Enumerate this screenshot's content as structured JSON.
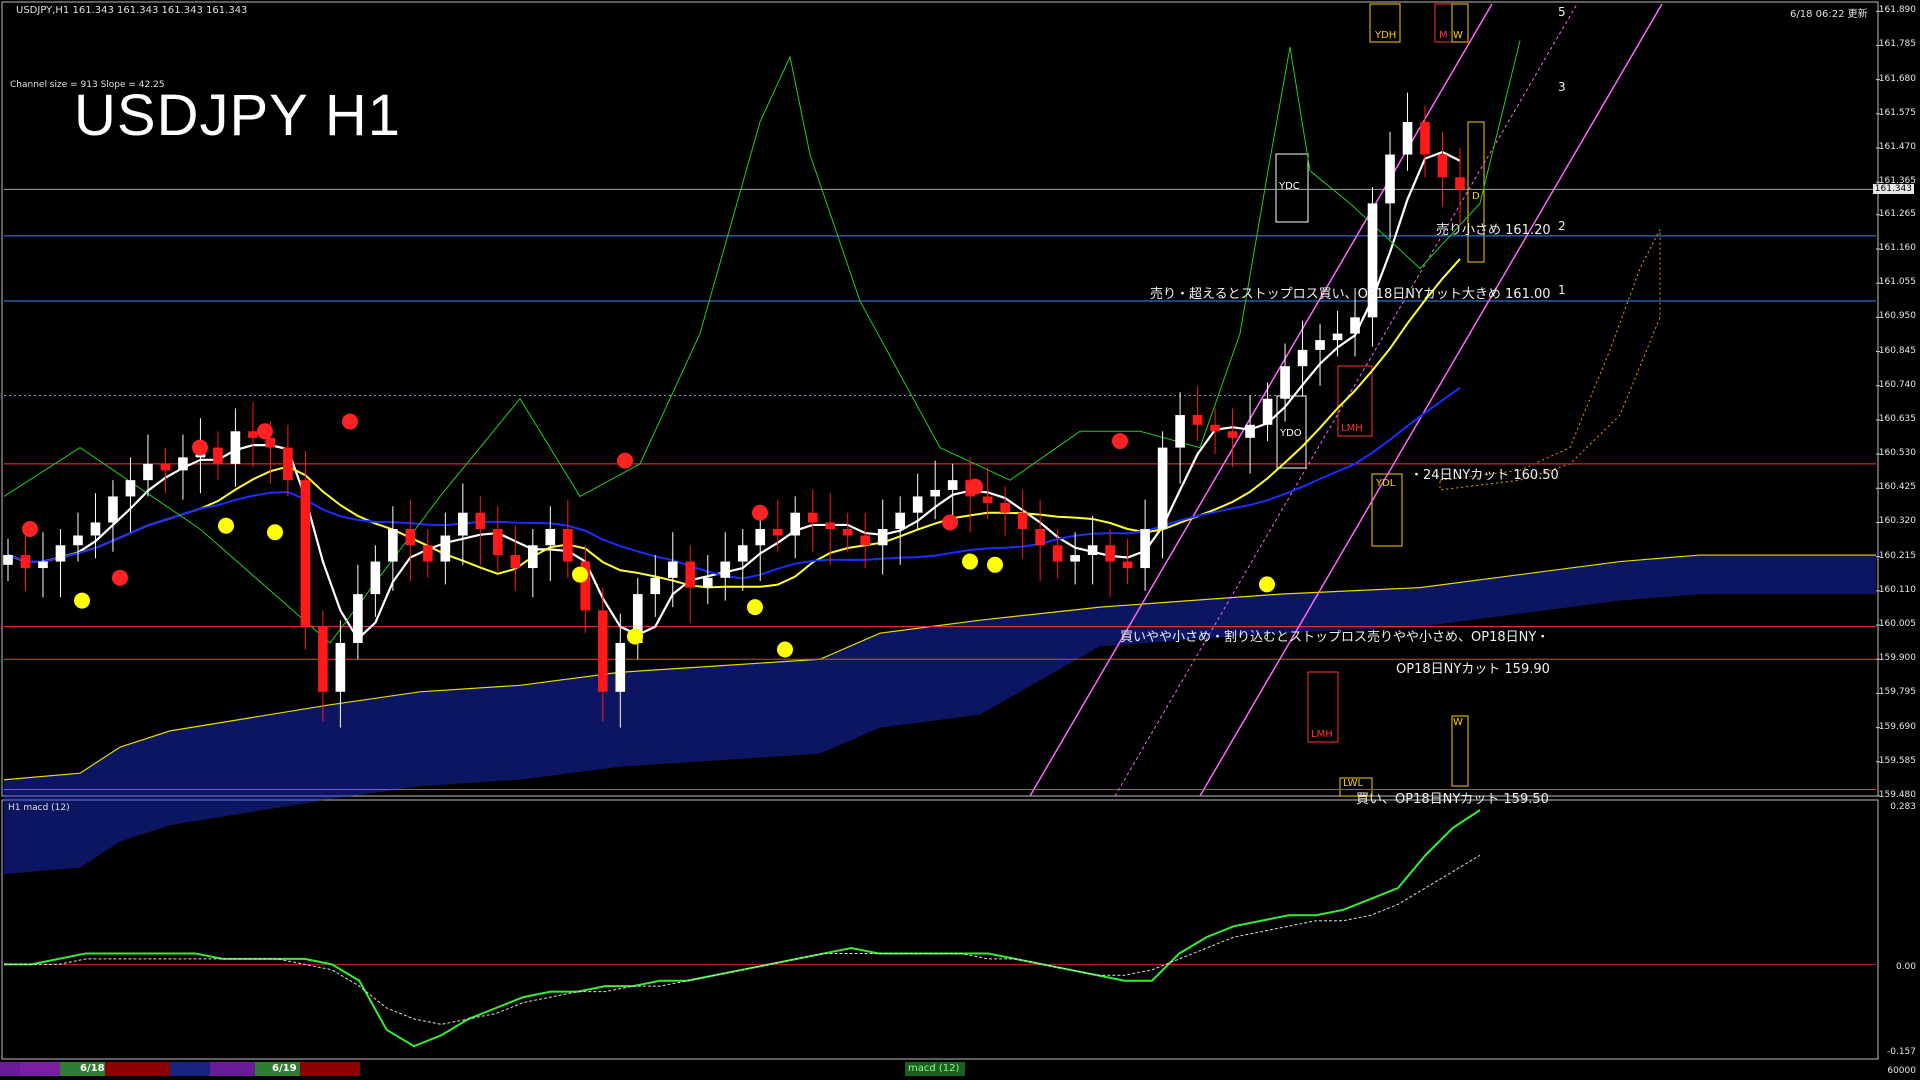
{
  "header": {
    "symbol_info": "USDJPY,H1  161.343 161.343 161.343 161.343",
    "datetime_label": "6/18 06:22 更新",
    "channel_info": "Channel size = 913 Slope = 42.25",
    "chart_title": "USDJPY H1"
  },
  "indicator_label": "H1  macd (12)",
  "colors": {
    "background": "#000000",
    "bull_candle": "#ffffff",
    "bear_candle": "#ff1a1a",
    "ma_white": "#ffffff",
    "ma_yellow": "#ffff33",
    "ma_blue": "#1a2eff",
    "channel_magenta": "#ff66ff",
    "kumo_blue": "#1a2fd6",
    "kumo_orange": "#ff9900",
    "green_osc": "#22cc22",
    "macd_green": "#33ee33",
    "macd_pink": "#ff8899",
    "blue_level": "#3a8cff",
    "red_level": "#ff3333"
  },
  "price_axis": {
    "labels": [
      "161.890",
      "161.785",
      "161.680",
      "161.575",
      "161.470",
      "161.365",
      "161.265",
      "161.160",
      "161.055",
      "160.950",
      "160.845",
      "160.740",
      "160.635",
      "160.530",
      "160.425",
      "160.320",
      "160.215",
      "160.110",
      "160.005",
      "159.900",
      "159.795",
      "159.690",
      "159.585",
      "159.480"
    ],
    "current_price": "161.343"
  },
  "macd_axis": {
    "labels": [
      "0.283",
      "0.00",
      "-0.157",
      "60000"
    ]
  },
  "levels": [
    {
      "label": "売り小さめ 161.20",
      "price": 161.2,
      "color": "#3a8cff",
      "number": "2"
    },
    {
      "label": "売り・超えるとストップロス買い、OP18日NYカット大きめ 161.00",
      "price": 161.0,
      "color": "#3a8cff",
      "number": "1"
    },
    {
      "label": "・24日NYカット 160.50",
      "price": 160.5,
      "color": "#ff3333",
      "number": ""
    },
    {
      "label": "買いやや小さめ・割り込むとストップロス売りやや小さめ、OP18日NY・",
      "price": 160.0,
      "color": "#ff3333",
      "number": ""
    },
    {
      "label": "OP18日NYカット 159.90",
      "price": 159.9,
      "color": "#ff3333",
      "number": ""
    },
    {
      "label": "買い、OP18日NYカット 159.50",
      "price": 159.5,
      "color": "#ff3333",
      "number": ""
    }
  ],
  "channel_numbers": [
    "5",
    "3"
  ],
  "box_tags": {
    "ydh": "YDH",
    "m": "M",
    "w": "W",
    "ydc": "YDC",
    "d": "D",
    "ydo": "YDO",
    "lmh": "LMH",
    "ydl": "YDL",
    "lmh2": "LMH",
    "w2": "W",
    "lwl": "LWL"
  },
  "date_tags": [
    "6/18",
    "6/19"
  ],
  "bottom_tab": "macd (12)",
  "chart_data": {
    "type": "candlestick",
    "title": "USDJPY H1",
    "timeframe": "H1",
    "ylim": [
      159.48,
      161.9
    ],
    "closes": [
      160.22,
      160.18,
      160.2,
      160.25,
      160.28,
      160.32,
      160.4,
      160.45,
      160.5,
      160.48,
      160.52,
      160.55,
      160.5,
      160.6,
      160.58,
      160.55,
      160.45,
      160.0,
      159.8,
      159.95,
      160.1,
      160.2,
      160.3,
      160.25,
      160.2,
      160.28,
      160.35,
      160.3,
      160.22,
      160.18,
      160.25,
      160.3,
      160.2,
      160.05,
      159.8,
      159.95,
      160.1,
      160.15,
      160.2,
      160.12,
      160.15,
      160.2,
      160.25,
      160.3,
      160.28,
      160.35,
      160.32,
      160.3,
      160.28,
      160.25,
      160.3,
      160.35,
      160.4,
      160.42,
      160.45,
      160.4,
      160.38,
      160.35,
      160.3,
      160.25,
      160.2,
      160.22,
      160.25,
      160.2,
      160.18,
      160.3,
      160.55,
      160.65,
      160.62,
      160.6,
      160.58,
      160.62,
      160.7,
      160.8,
      160.85,
      160.88,
      160.9,
      160.95,
      161.3,
      161.45,
      161.55,
      161.45,
      161.38,
      161.343
    ],
    "current_price": 161.343,
    "levels": [
      161.2,
      161.0,
      160.5,
      160.0,
      159.9,
      159.5
    ],
    "macd": {
      "zero_line": 0.0,
      "ylim": [
        -0.157,
        0.283
      ],
      "main_values": [
        0.0,
        0.0,
        0.01,
        0.02,
        0.02,
        0.02,
        0.02,
        0.02,
        0.01,
        0.01,
        0.01,
        0.01,
        0.0,
        -0.03,
        -0.12,
        -0.15,
        -0.13,
        -0.1,
        -0.08,
        -0.06,
        -0.05,
        -0.05,
        -0.04,
        -0.04,
        -0.03,
        -0.03,
        -0.02,
        -0.01,
        0.0,
        0.01,
        0.02,
        0.03,
        0.02,
        0.02,
        0.02,
        0.02,
        0.02,
        0.01,
        0.0,
        -0.01,
        -0.02,
        -0.03,
        -0.03,
        0.02,
        0.05,
        0.07,
        0.08,
        0.09,
        0.09,
        0.1,
        0.12,
        0.14,
        0.2,
        0.25,
        0.283
      ],
      "signal_values": [
        0.0,
        0.0,
        0.0,
        0.01,
        0.01,
        0.01,
        0.01,
        0.01,
        0.01,
        0.01,
        0.01,
        0.0,
        -0.01,
        -0.04,
        -0.08,
        -0.1,
        -0.11,
        -0.1,
        -0.09,
        -0.07,
        -0.06,
        -0.05,
        -0.05,
        -0.04,
        -0.04,
        -0.03,
        -0.02,
        -0.01,
        0.0,
        0.01,
        0.02,
        0.02,
        0.02,
        0.02,
        0.02,
        0.02,
        0.01,
        0.01,
        0.0,
        -0.01,
        -0.02,
        -0.02,
        -0.01,
        0.01,
        0.03,
        0.05,
        0.06,
        0.07,
        0.08,
        0.08,
        0.09,
        0.11,
        0.14,
        0.17,
        0.2
      ]
    }
  }
}
